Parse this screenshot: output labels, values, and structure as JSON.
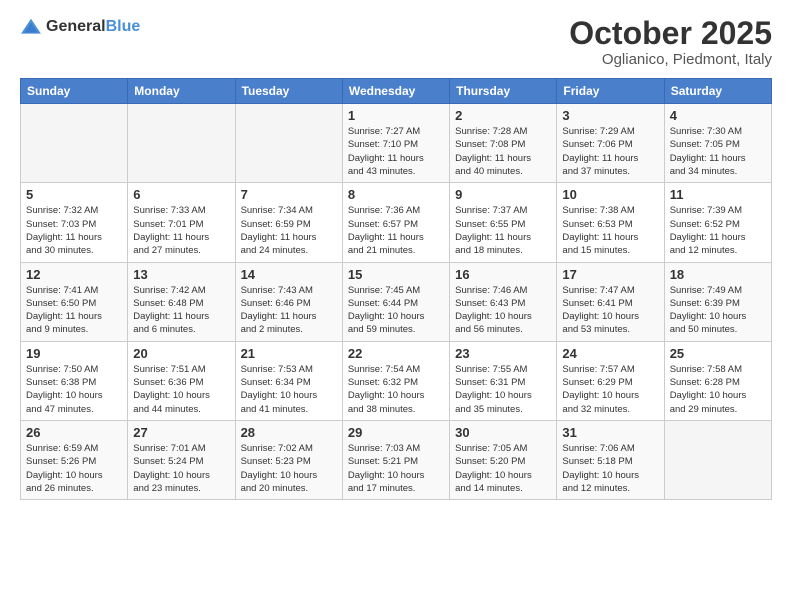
{
  "header": {
    "logo": {
      "general": "General",
      "blue": "Blue"
    },
    "title": "October 2025",
    "location": "Oglianico, Piedmont, Italy"
  },
  "calendar": {
    "days_of_week": [
      "Sunday",
      "Monday",
      "Tuesday",
      "Wednesday",
      "Thursday",
      "Friday",
      "Saturday"
    ],
    "weeks": [
      [
        {
          "day": "",
          "info": ""
        },
        {
          "day": "",
          "info": ""
        },
        {
          "day": "",
          "info": ""
        },
        {
          "day": "1",
          "info": "Sunrise: 7:27 AM\nSunset: 7:10 PM\nDaylight: 11 hours\nand 43 minutes."
        },
        {
          "day": "2",
          "info": "Sunrise: 7:28 AM\nSunset: 7:08 PM\nDaylight: 11 hours\nand 40 minutes."
        },
        {
          "day": "3",
          "info": "Sunrise: 7:29 AM\nSunset: 7:06 PM\nDaylight: 11 hours\nand 37 minutes."
        },
        {
          "day": "4",
          "info": "Sunrise: 7:30 AM\nSunset: 7:05 PM\nDaylight: 11 hours\nand 34 minutes."
        }
      ],
      [
        {
          "day": "5",
          "info": "Sunrise: 7:32 AM\nSunset: 7:03 PM\nDaylight: 11 hours\nand 30 minutes."
        },
        {
          "day": "6",
          "info": "Sunrise: 7:33 AM\nSunset: 7:01 PM\nDaylight: 11 hours\nand 27 minutes."
        },
        {
          "day": "7",
          "info": "Sunrise: 7:34 AM\nSunset: 6:59 PM\nDaylight: 11 hours\nand 24 minutes."
        },
        {
          "day": "8",
          "info": "Sunrise: 7:36 AM\nSunset: 6:57 PM\nDaylight: 11 hours\nand 21 minutes."
        },
        {
          "day": "9",
          "info": "Sunrise: 7:37 AM\nSunset: 6:55 PM\nDaylight: 11 hours\nand 18 minutes."
        },
        {
          "day": "10",
          "info": "Sunrise: 7:38 AM\nSunset: 6:53 PM\nDaylight: 11 hours\nand 15 minutes."
        },
        {
          "day": "11",
          "info": "Sunrise: 7:39 AM\nSunset: 6:52 PM\nDaylight: 11 hours\nand 12 minutes."
        }
      ],
      [
        {
          "day": "12",
          "info": "Sunrise: 7:41 AM\nSunset: 6:50 PM\nDaylight: 11 hours\nand 9 minutes."
        },
        {
          "day": "13",
          "info": "Sunrise: 7:42 AM\nSunset: 6:48 PM\nDaylight: 11 hours\nand 6 minutes."
        },
        {
          "day": "14",
          "info": "Sunrise: 7:43 AM\nSunset: 6:46 PM\nDaylight: 11 hours\nand 2 minutes."
        },
        {
          "day": "15",
          "info": "Sunrise: 7:45 AM\nSunset: 6:44 PM\nDaylight: 10 hours\nand 59 minutes."
        },
        {
          "day": "16",
          "info": "Sunrise: 7:46 AM\nSunset: 6:43 PM\nDaylight: 10 hours\nand 56 minutes."
        },
        {
          "day": "17",
          "info": "Sunrise: 7:47 AM\nSunset: 6:41 PM\nDaylight: 10 hours\nand 53 minutes."
        },
        {
          "day": "18",
          "info": "Sunrise: 7:49 AM\nSunset: 6:39 PM\nDaylight: 10 hours\nand 50 minutes."
        }
      ],
      [
        {
          "day": "19",
          "info": "Sunrise: 7:50 AM\nSunset: 6:38 PM\nDaylight: 10 hours\nand 47 minutes."
        },
        {
          "day": "20",
          "info": "Sunrise: 7:51 AM\nSunset: 6:36 PM\nDaylight: 10 hours\nand 44 minutes."
        },
        {
          "day": "21",
          "info": "Sunrise: 7:53 AM\nSunset: 6:34 PM\nDaylight: 10 hours\nand 41 minutes."
        },
        {
          "day": "22",
          "info": "Sunrise: 7:54 AM\nSunset: 6:32 PM\nDaylight: 10 hours\nand 38 minutes."
        },
        {
          "day": "23",
          "info": "Sunrise: 7:55 AM\nSunset: 6:31 PM\nDaylight: 10 hours\nand 35 minutes."
        },
        {
          "day": "24",
          "info": "Sunrise: 7:57 AM\nSunset: 6:29 PM\nDaylight: 10 hours\nand 32 minutes."
        },
        {
          "day": "25",
          "info": "Sunrise: 7:58 AM\nSunset: 6:28 PM\nDaylight: 10 hours\nand 29 minutes."
        }
      ],
      [
        {
          "day": "26",
          "info": "Sunrise: 6:59 AM\nSunset: 5:26 PM\nDaylight: 10 hours\nand 26 minutes."
        },
        {
          "day": "27",
          "info": "Sunrise: 7:01 AM\nSunset: 5:24 PM\nDaylight: 10 hours\nand 23 minutes."
        },
        {
          "day": "28",
          "info": "Sunrise: 7:02 AM\nSunset: 5:23 PM\nDaylight: 10 hours\nand 20 minutes."
        },
        {
          "day": "29",
          "info": "Sunrise: 7:03 AM\nSunset: 5:21 PM\nDaylight: 10 hours\nand 17 minutes."
        },
        {
          "day": "30",
          "info": "Sunrise: 7:05 AM\nSunset: 5:20 PM\nDaylight: 10 hours\nand 14 minutes."
        },
        {
          "day": "31",
          "info": "Sunrise: 7:06 AM\nSunset: 5:18 PM\nDaylight: 10 hours\nand 12 minutes."
        },
        {
          "day": "",
          "info": ""
        }
      ]
    ]
  }
}
